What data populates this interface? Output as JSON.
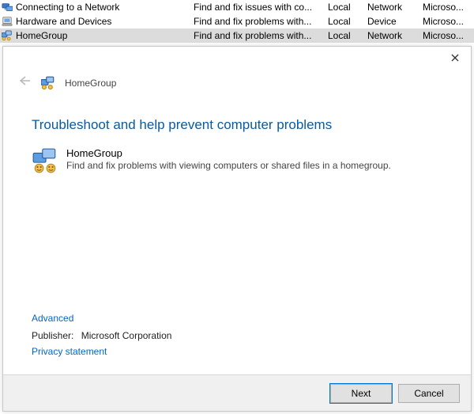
{
  "list": {
    "rows": [
      {
        "name": "Connecting to a Network",
        "desc": "Find and fix issues with co...",
        "a": "Local",
        "b": "Network",
        "c": "Microso...",
        "icon": "network",
        "selected": false
      },
      {
        "name": "Hardware and Devices",
        "desc": "Find and fix problems with...",
        "a": "Local",
        "b": "Device",
        "c": "Microso...",
        "icon": "device",
        "selected": false
      },
      {
        "name": "HomeGroup",
        "desc": "Find and fix problems with...",
        "a": "Local",
        "b": "Network",
        "c": "Microso...",
        "icon": "homegroup",
        "selected": true
      }
    ]
  },
  "dialog": {
    "crumb": "HomeGroup",
    "heading": "Troubleshoot and help prevent computer problems",
    "item_title": "HomeGroup",
    "item_desc": "Find and fix problems with viewing computers or shared files in a homegroup.",
    "advanced": "Advanced",
    "publisher_label": "Publisher:",
    "publisher_value": "Microsoft Corporation",
    "privacy": "Privacy statement",
    "next": "Next",
    "cancel": "Cancel"
  }
}
